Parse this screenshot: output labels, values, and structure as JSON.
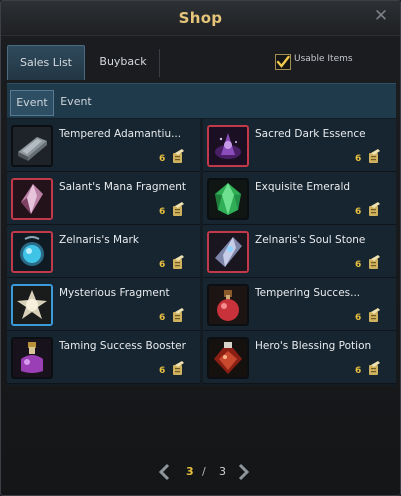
{
  "window": {
    "title": "Shop",
    "close_symbol": "✕"
  },
  "tabs": [
    {
      "label": "Sales List",
      "active": true
    },
    {
      "label": "Buyback",
      "active": false
    }
  ],
  "filter": {
    "label": "Usable Items",
    "checked": true
  },
  "subtabs": [
    {
      "label": "Event",
      "active": true
    },
    {
      "label": "Event",
      "active": false
    }
  ],
  "items": [
    {
      "name": "Tempered Adamantiu...",
      "price": "6",
      "icon": "adamantium-ingot-icon",
      "border": "none"
    },
    {
      "name": "Sacred Dark Essence",
      "price": "6",
      "icon": "dark-essence-icon",
      "border": "#c2394a"
    },
    {
      "name": "Salant's Mana Fragment",
      "price": "6",
      "icon": "mana-fragment-icon",
      "border": "#c2394a"
    },
    {
      "name": "Exquisite Emerald",
      "price": "6",
      "icon": "emerald-icon",
      "border": "none"
    },
    {
      "name": "Zelnaris's Mark",
      "price": "6",
      "icon": "zelnaris-mark-icon",
      "border": "#c2394a"
    },
    {
      "name": "Zelnaris's Soul Stone",
      "price": "6",
      "icon": "soul-stone-icon",
      "border": "#c2394a"
    },
    {
      "name": "Mysterious Fragment",
      "price": "6",
      "icon": "mysterious-fragment-icon",
      "border": "#3a9bd8"
    },
    {
      "name": "Tempering Succes...",
      "price": "6",
      "icon": "tempering-potion-icon",
      "border": "none"
    },
    {
      "name": "Taming Success Booster",
      "price": "6",
      "icon": "taming-potion-icon",
      "border": "none"
    },
    {
      "name": "Hero's Blessing Potion",
      "price": "6",
      "icon": "blessing-potion-icon",
      "border": "none"
    }
  ],
  "pagination": {
    "current": "3",
    "separator": "/",
    "total": "3"
  },
  "colors": {
    "title_gold": "#e5c57a",
    "price_gold": "#e7c040",
    "rare_border": "#c2394a",
    "blue_border": "#3a9bd8"
  }
}
